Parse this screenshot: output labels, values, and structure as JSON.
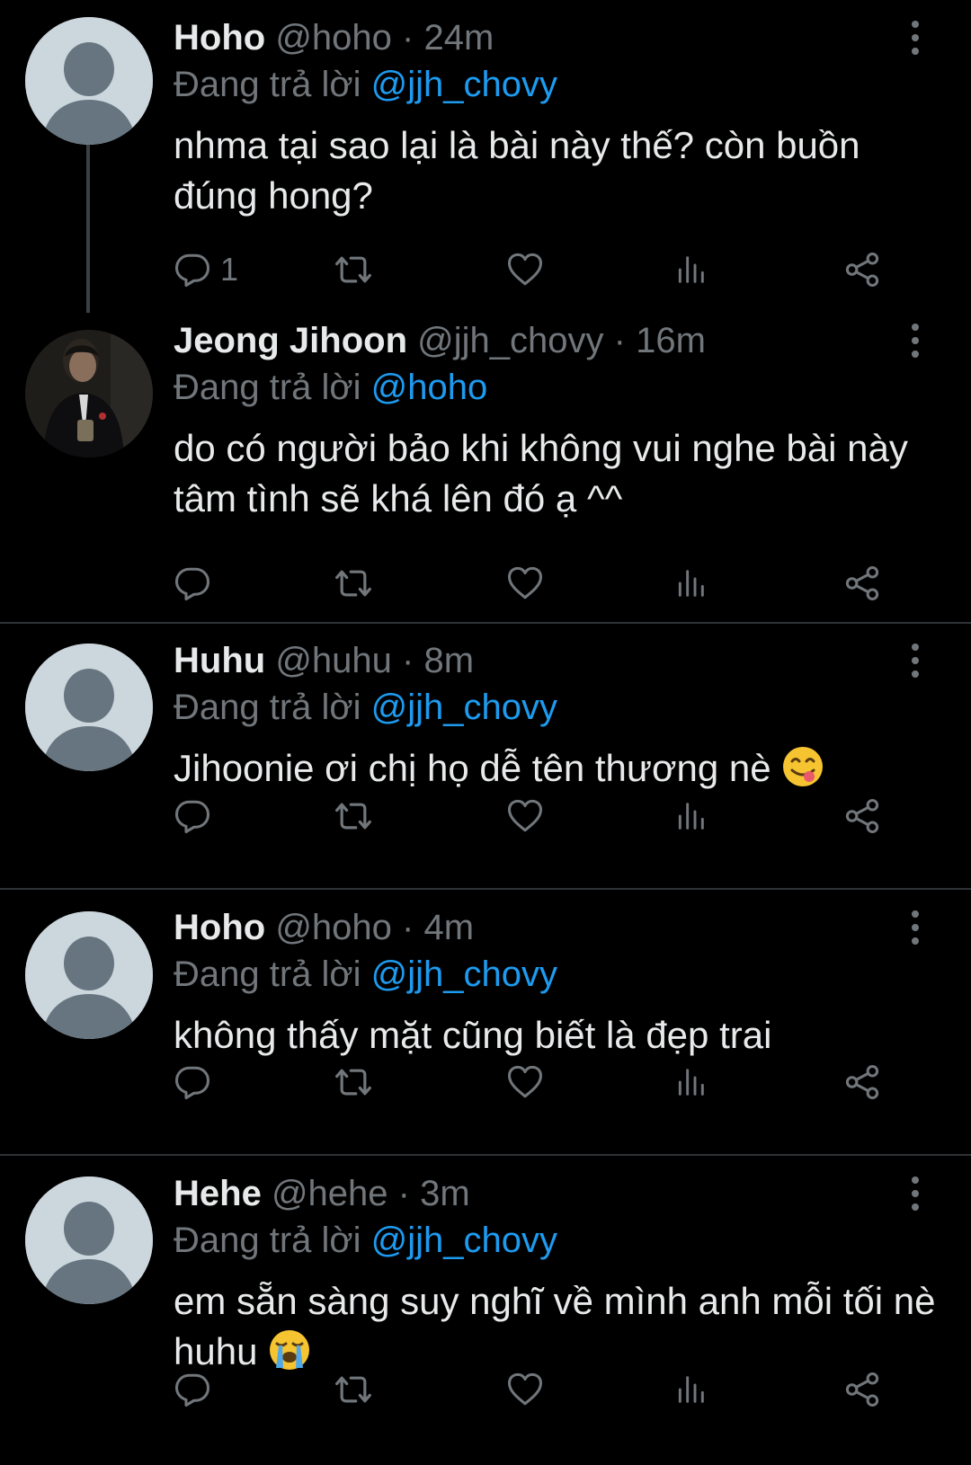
{
  "colors": {
    "background": "#000000",
    "text": "#e7e9ea",
    "muted": "#71767b",
    "link": "#1d9bf0",
    "divider": "#2f3336",
    "avatar_placeholder_bg": "#ccd6dd",
    "avatar_placeholder_fg": "#66757f"
  },
  "tweets": [
    {
      "name": "Hoho",
      "handle": "@hoho",
      "separator": "·",
      "time": "24m",
      "replying_prefix": "Đang trả lời ",
      "replying_to": "@jjh_chovy",
      "text": "nhma tại sao lại là bài này thế? còn buồn đúng hong?",
      "reply_count": "1",
      "avatar": "default-avatar-icon"
    },
    {
      "name": "Jeong Jihoon",
      "handle": "@jjh_chovy",
      "separator": "·",
      "time": "16m",
      "replying_prefix": "Đang trả lời ",
      "replying_to": "@hoho",
      "text": "do có người bảo khi không vui nghe bài này tâm tình sẽ khá lên đó ạ ^^",
      "reply_count": "",
      "avatar": "profile-photo"
    },
    {
      "name": "Huhu",
      "handle": "@huhu",
      "separator": "·",
      "time": "8m",
      "replying_prefix": "Đang trả lời ",
      "replying_to": "@jjh_chovy",
      "text": "Jihoonie ơi chị họ dễ tên thương nè",
      "emoji": "face-savoring-food-emoji",
      "reply_count": "",
      "avatar": "default-avatar-icon"
    },
    {
      "name": "Hoho",
      "handle": "@hoho",
      "separator": "·",
      "time": "4m",
      "replying_prefix": "Đang trả lời ",
      "replying_to": "@jjh_chovy",
      "text": "không thấy mặt cũng biết là đẹp trai",
      "reply_count": "",
      "avatar": "default-avatar-icon"
    },
    {
      "name": "Hehe",
      "handle": "@hehe",
      "separator": "·",
      "time": "3m",
      "replying_prefix": "Đang trả lời ",
      "replying_to": "@jjh_chovy",
      "text": "em sẵn sàng suy nghĩ về mình anh mỗi tối nè huhu",
      "emoji": "loudly-crying-face-emoji",
      "reply_count": "",
      "avatar": "default-avatar-icon"
    }
  ],
  "icons": {
    "more": "more-vertical-icon",
    "reply": "reply-icon",
    "retweet": "retweet-icon",
    "like": "heart-icon",
    "views": "analytics-icon",
    "share": "share-icon"
  }
}
